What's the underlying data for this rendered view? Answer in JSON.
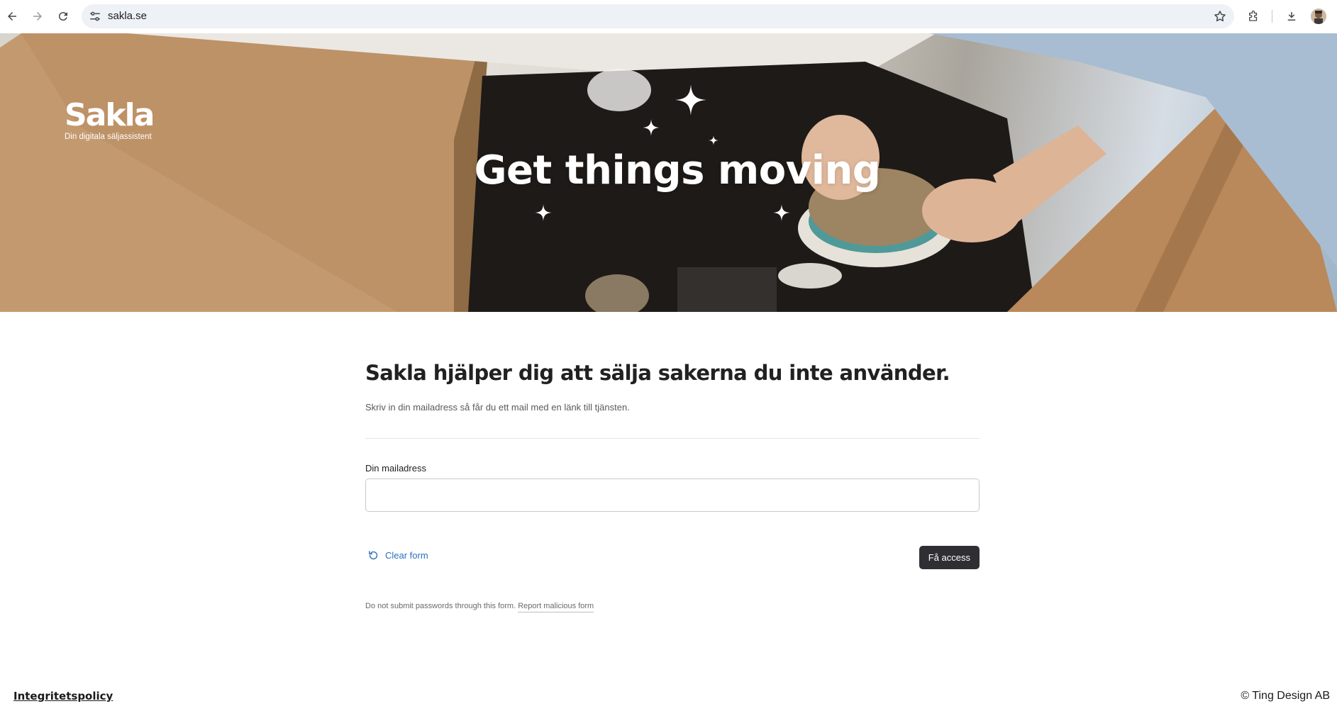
{
  "browser": {
    "url": "sakla.se",
    "icons": [
      "back-arrow-icon",
      "forward-arrow-icon",
      "reload-icon",
      "site-settings-icon",
      "bookmark-star-icon",
      "extensions-icon",
      "download-icon",
      "profile-avatar-icon"
    ]
  },
  "hero": {
    "brand_name": "Sakla",
    "brand_tagline": "Din digitala säljassistent",
    "title": "Get things moving"
  },
  "form": {
    "headline": "Sakla hjälper dig att sälja sakerna du inte använder.",
    "description": "Skriv in din mailadress så får du ett mail med en länk till tjänsten.",
    "email_label": "Din mailadress",
    "email_value": "",
    "email_placeholder": "",
    "clear_label": "Clear form",
    "submit_label": "Få access",
    "notice_text": "Do not submit passwords through this form.",
    "report_link": "Report malicious form"
  },
  "footer": {
    "privacy_link": "Integritetspolicy",
    "copyright": "© Ting Design AB"
  },
  "colors": {
    "submit_bg": "#2f2f33",
    "link_blue": "#2b6fc2",
    "hero_text": "#ffffff"
  }
}
